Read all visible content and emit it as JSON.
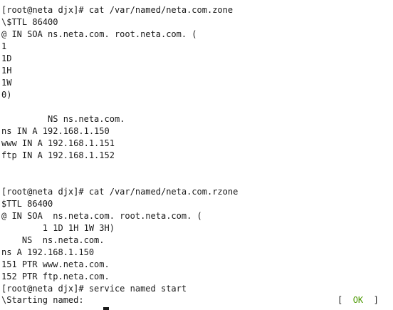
{
  "terminal": {
    "lines": [
      "[root@neta djx]# cat /var/named/neta.com.zone",
      "\\$TTL 86400",
      "@ IN SOA ns.neta.com. root.neta.com. (",
      "1",
      "1D",
      "1H",
      "1W",
      "0)",
      "",
      "         NS ns.neta.com.",
      "ns IN A 192.168.1.150",
      "www IN A 192.168.1.151",
      "ftp IN A 192.168.1.152",
      "",
      "",
      "[root@neta djx]# cat /var/named/neta.com.rzone",
      "$TTL 86400",
      "@ IN SOA  ns.neta.com. root.neta.com. (",
      "        1 1D 1H 1W 3H)",
      "    NS  ns.neta.com.",
      "ns A 192.168.1.150",
      "151 PTR www.neta.com.",
      "152 PTR ftp.neta.com.",
      "[root@neta djx]# service named start",
      "\\Starting named:"
    ],
    "status": {
      "open_bracket": "[  ",
      "ok": "OK",
      "close_bracket": "  ]"
    }
  }
}
